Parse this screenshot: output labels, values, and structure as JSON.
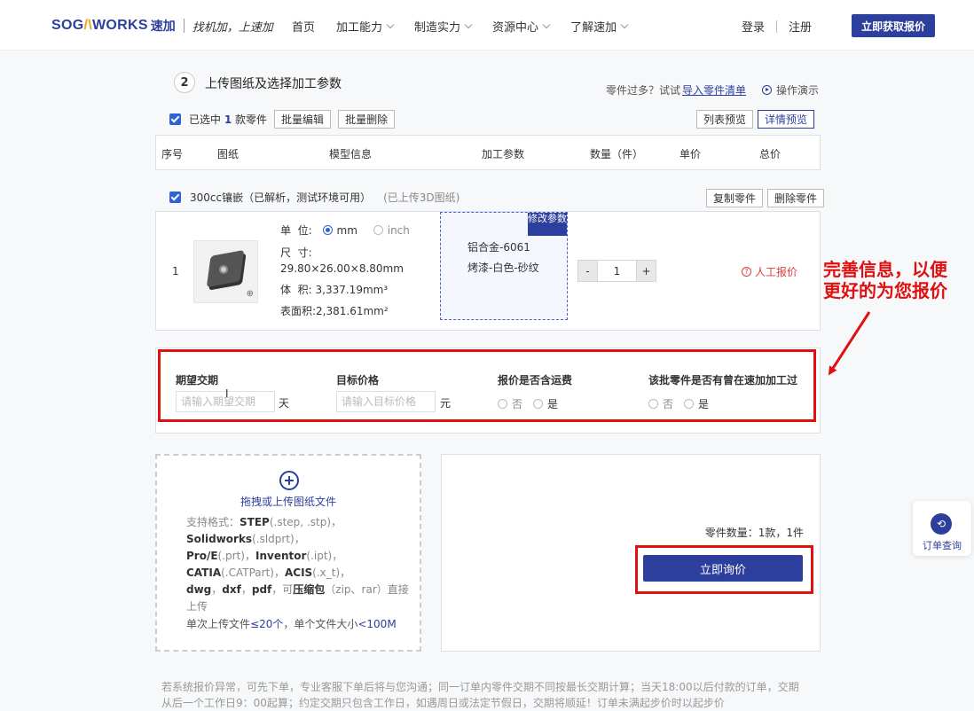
{
  "header": {
    "logo_prefix": "SOG",
    "logo_a": "/\\",
    "logo_suffix": "WORKS",
    "logo_cn": "速加",
    "slogan": "找机加，上速加",
    "nav": [
      {
        "label": "首页",
        "dropdown": false
      },
      {
        "label": "加工能力",
        "dropdown": true
      },
      {
        "label": "制造实力",
        "dropdown": true
      },
      {
        "label": "资源中心",
        "dropdown": true
      },
      {
        "label": "了解速加",
        "dropdown": true
      }
    ],
    "login": "登录",
    "register": "注册",
    "cta": "立即获取报价"
  },
  "step": {
    "number": "2",
    "title": "上传图纸及选择加工参数",
    "hint_text": "零件过多？试试",
    "hint_link": "导入零件清单",
    "demo": "操作演示"
  },
  "toolbar": {
    "selected_prefix": "已选中",
    "selected_count": "1",
    "selected_suffix": "款零件",
    "batch_edit": "批量编辑",
    "batch_delete": "批量删除",
    "list_view": "列表预览",
    "detail_view": "详情预览"
  },
  "table_headers": [
    "序号",
    "图纸",
    "模型信息",
    "加工参数",
    "数量（件）",
    "单价",
    "总价"
  ],
  "part": {
    "name": "300cc镶嵌（已解析，测试环境可用）",
    "uploaded": "(已上传3D图纸)",
    "copy": "复制零件",
    "delete": "删除零件",
    "index": "1",
    "unit_label": "单  位:",
    "unit_mm": "mm",
    "unit_inch": "inch",
    "size_label": "尺  寸:",
    "size": "29.80×26.00×8.80mm",
    "volume_label": "体  积:",
    "volume": "3,337.19mm³",
    "area_label": "表面积:",
    "area": "2,381.61mm²",
    "edit_params": "修改参数",
    "material": "铝合金-6061",
    "finish": "烤漆-白色-砂纹",
    "qty_minus": "-",
    "qty": "1",
    "qty_plus": "+",
    "manual_quote": "人工报价"
  },
  "info": {
    "delivery_label": "期望交期",
    "delivery_placeholder": "请输入期望交期",
    "delivery_unit": "天",
    "price_label": "目标价格",
    "price_placeholder": "请输入目标价格",
    "price_unit": "元",
    "shipping_label": "报价是否含运费",
    "prev_label": "该批零件是否有曾在速加加工过",
    "no": "否",
    "yes": "是"
  },
  "annotation": [
    "完善信息，以便",
    "更好的为您报价"
  ],
  "upload": {
    "drag": "拖拽或上传图纸文件",
    "formats_prefix": "支持格式：",
    "step": "STEP",
    "step_ext": "(.step, .stp)，",
    "sw": "Solidworks",
    "sw_ext": "(.sldprt)，",
    "proe": "Pro/E",
    "proe_ext": "(.prt)，",
    "inventor": "Inventor",
    "inventor_ext": "(.ipt)，",
    "catia": "CATIA",
    "catia_ext": "(.CATPart)，",
    "acis": "ACIS",
    "acis_ext": "(.x_t)，",
    "dwg": "dwg",
    "dxf": "dxf",
    "pdf": "pdf",
    "zip_prefix": "，可",
    "zip": "压缩包",
    "zip_ext": "（zip、rar）直接上传",
    "limits_a": "单次上传文件",
    "limits_b": "≤20个",
    "limits_c": "，单个文件大小",
    "limits_d": "<100M"
  },
  "summary": {
    "count": "零件数量：1款，1件",
    "inquire": "立即询价"
  },
  "side_widget": {
    "label": "订单查询"
  },
  "footer_note": "若系统报价异常，可先下单，专业客服下单后将与您沟通；同一订单内零件交期不同按最长交期计算；当天18:00以后付款的订单，交期从后一个工作日9：00起算；约定交期只包含工作日，如遇周日或法定节假日，交期将顺延！订单未满起步价时以起步价"
}
